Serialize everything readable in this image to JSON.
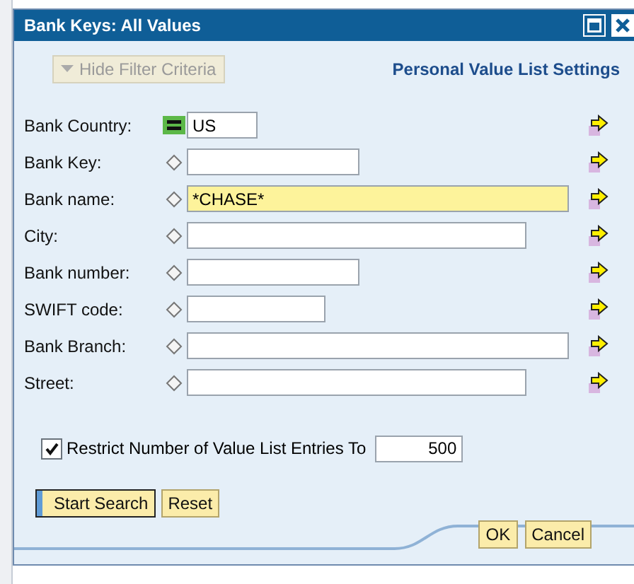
{
  "window": {
    "title": "Bank Keys: All Values"
  },
  "toolbar": {
    "toggle_label": "Hide Filter Criteria",
    "settings_link": "Personal Value List Settings"
  },
  "fields": [
    {
      "label": "Bank Country:",
      "kind": "equals",
      "value": "US",
      "highlighted": false
    },
    {
      "label": "Bank Key:",
      "kind": "pattern",
      "highlighted": false
    },
    {
      "label": "Bank name:",
      "kind": "pattern",
      "value": "*CHASE*",
      "highlighted": true
    },
    {
      "label": "City:",
      "kind": "pattern",
      "highlighted": false
    },
    {
      "label": "Bank number:",
      "kind": "pattern",
      "highlighted": false
    },
    {
      "label": "SWIFT code:",
      "kind": "pattern",
      "highlighted": false
    },
    {
      "label": "Bank Branch:",
      "kind": "pattern",
      "highlighted": false
    },
    {
      "label": "Street:",
      "kind": "pattern",
      "highlighted": false
    }
  ],
  "restrict": {
    "label": "Restrict Number of Value List Entries To",
    "checked": true,
    "value": "500"
  },
  "search_buttons": [
    {
      "label": "Start Search",
      "focused": true
    },
    {
      "label": "Reset",
      "focused": false
    }
  ],
  "footer_buttons": [
    {
      "label": "OK",
      "focused": false
    },
    {
      "label": "Cancel",
      "focused": false
    }
  ]
}
